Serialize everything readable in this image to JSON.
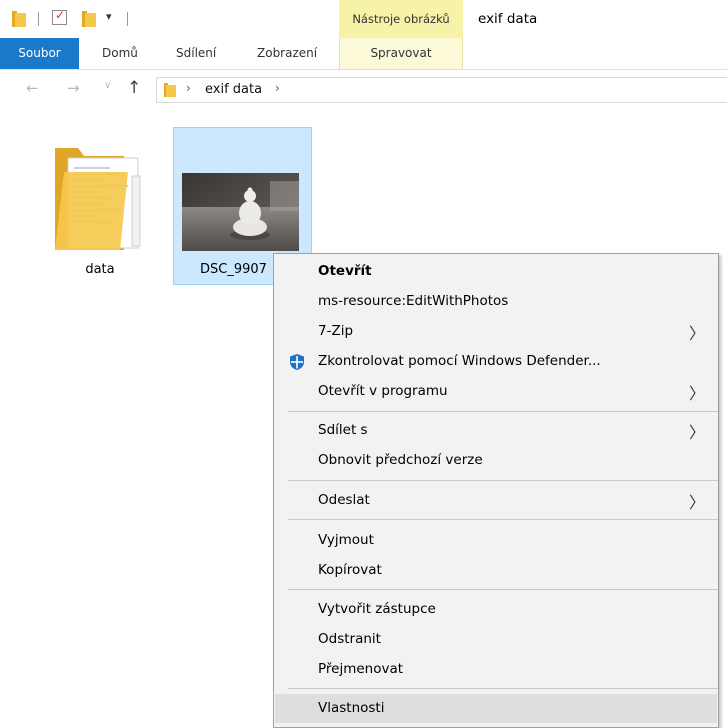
{
  "title_bar": {
    "context_tab_header": "Nástroje obrázků",
    "window_title": "exif data"
  },
  "ribbon": {
    "tabs": [
      {
        "label": "Soubor"
      },
      {
        "label": "Domů"
      },
      {
        "label": "Sdílení"
      },
      {
        "label": "Zobrazení"
      },
      {
        "label": "Spravovat"
      }
    ]
  },
  "address_bar": {
    "path": "exif data"
  },
  "items": [
    {
      "name": "data",
      "type": "folder"
    },
    {
      "name": "DSC_9907",
      "type": "image",
      "selected": true
    }
  ],
  "context_menu": {
    "items": [
      {
        "label": "Otevřít",
        "bold": true
      },
      {
        "label": "ms-resource:EditWithPhotos"
      },
      {
        "label": "7-Zip",
        "submenu": true
      },
      {
        "label": "Zkontrolovat pomocí Windows Defender...",
        "icon": "defender-shield-icon"
      },
      {
        "label": "Otevřít v programu",
        "submenu": true
      },
      {
        "label": "Sdílet s",
        "submenu": true
      },
      {
        "label": "Obnovit předchozí verze"
      },
      {
        "label": "Odeslat",
        "submenu": true
      },
      {
        "label": "Vyjmout"
      },
      {
        "label": "Kopírovat"
      },
      {
        "label": "Vytvořit zástupce"
      },
      {
        "label": "Odstranit"
      },
      {
        "label": "Přejmenovat"
      },
      {
        "label": "Vlastnosti",
        "highlighted": true
      }
    ]
  },
  "colors": {
    "file_tab": "#1979ca",
    "context_tab": "#f6f3a8",
    "selection": "#cce8ff",
    "menu_background": "#f2f2f2",
    "folder_yellow": "#f5c84c"
  }
}
